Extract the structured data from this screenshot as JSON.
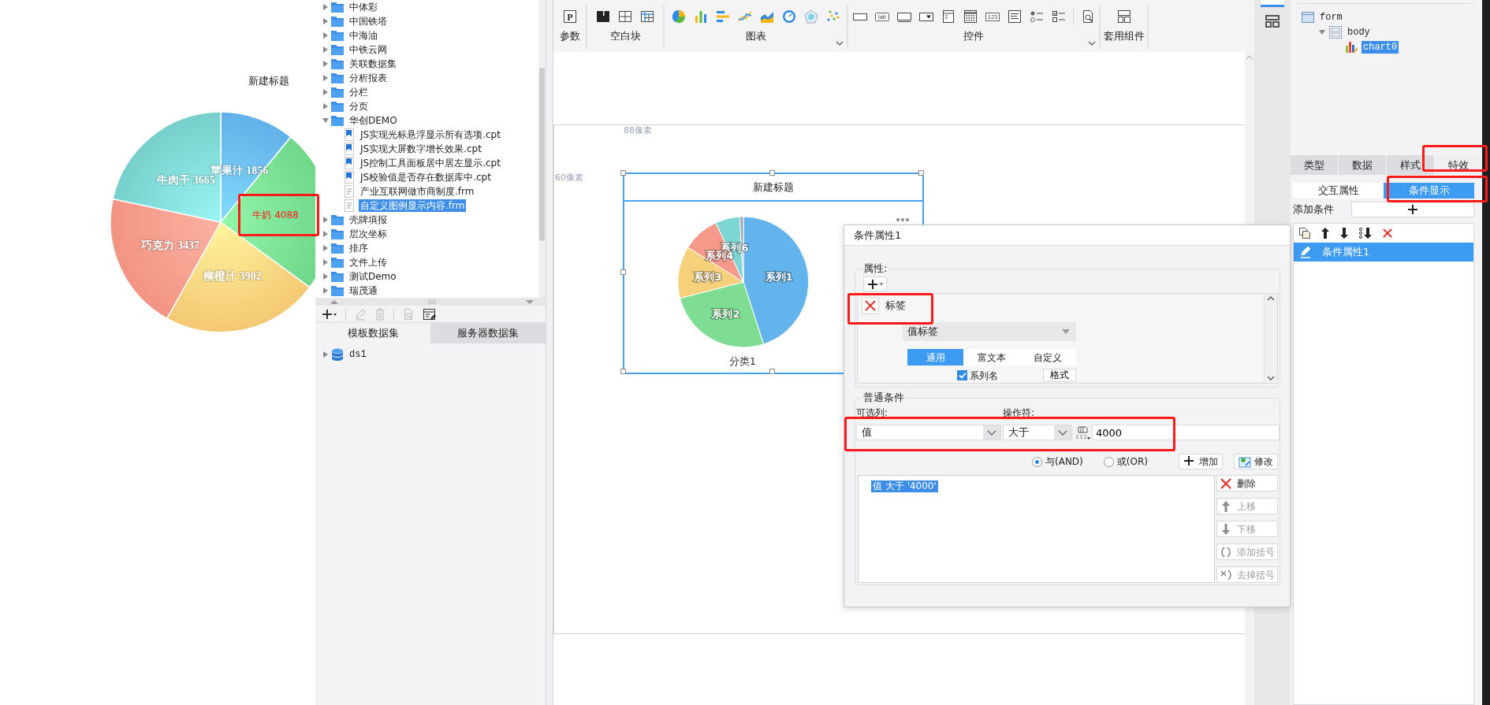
{
  "preview_chart": {
    "chart_data": {
      "type": "pie",
      "title": "新建标题",
      "categories": [
        "苹果汁",
        "牛奶",
        "柳橙汁",
        "巧克力",
        "牛肉干"
      ],
      "values": [
        1856,
        4088,
        3902,
        3437,
        3665
      ],
      "data_labels": true
    },
    "slices": [
      {
        "highlighted": false
      },
      {
        "highlighted": true
      },
      {
        "highlighted": false
      },
      {
        "highlighted": false
      },
      {
        "highlighted": false
      }
    ]
  },
  "file_tree": {
    "items": [
      {
        "label": "中体彩",
        "kind": "folder",
        "expanded": false,
        "selected": false
      },
      {
        "label": "中国铁塔",
        "kind": "folder",
        "expanded": false,
        "selected": false
      },
      {
        "label": "中海油",
        "kind": "folder",
        "expanded": false,
        "selected": false
      },
      {
        "label": "中铁云网",
        "kind": "folder",
        "expanded": false,
        "selected": false
      },
      {
        "label": "关联数据集",
        "kind": "folder",
        "expanded": false,
        "selected": false
      },
      {
        "label": "分析报表",
        "kind": "folder",
        "expanded": false,
        "selected": false
      },
      {
        "label": "分栏",
        "kind": "folder",
        "expanded": false,
        "selected": false
      },
      {
        "label": "分页",
        "kind": "folder",
        "expanded": false,
        "selected": false
      },
      {
        "label": "华创DEMO",
        "kind": "folder",
        "expanded": true,
        "selected": false,
        "children": [
          {
            "label": "JS实现光标悬浮显示所有选项.cpt",
            "kind": "report",
            "selected": false
          },
          {
            "label": "JS实现大屏数字增长效果.cpt",
            "kind": "report",
            "selected": false
          },
          {
            "label": "JS控制工具面板居中居左显示.cpt",
            "kind": "report",
            "selected": false
          },
          {
            "label": "JS校验值是否存在数据库中.cpt",
            "kind": "report",
            "selected": false
          },
          {
            "label": "产业互联网做市商制度.frm",
            "kind": "form",
            "selected": false
          },
          {
            "label": "自定义图例显示内容.frm",
            "kind": "form",
            "selected": true
          }
        ]
      },
      {
        "label": "壳牌填报",
        "kind": "folder",
        "expanded": false,
        "selected": false
      },
      {
        "label": "层次坐标",
        "kind": "folder",
        "expanded": false,
        "selected": false
      },
      {
        "label": "排序",
        "kind": "folder",
        "expanded": false,
        "selected": false
      },
      {
        "label": "文件上传",
        "kind": "folder",
        "expanded": false,
        "selected": false
      },
      {
        "label": "测试Demo",
        "kind": "folder",
        "expanded": false,
        "selected": false
      },
      {
        "label": "瑞茂通",
        "kind": "folder",
        "expanded": false,
        "selected": false
      }
    ]
  },
  "dataset_panel": {
    "tools": [
      {
        "kind": "add",
        "disabled": false
      },
      {
        "kind": "edit",
        "disabled": true
      },
      {
        "kind": "delete",
        "disabled": true
      },
      {
        "kind": "preview",
        "disabled": true
      },
      {
        "kind": "sql",
        "disabled": false
      }
    ],
    "tabs": [
      {
        "label": "模板数据集",
        "selected": true
      },
      {
        "label": "服务器数据集",
        "selected": false
      }
    ],
    "items": [
      {
        "label": "ds1",
        "expanded": false
      }
    ]
  },
  "toolbar": {
    "groups": [
      {
        "label": "参数",
        "menu": false,
        "icons": [
          {
            "kind": "param",
            "text": "P"
          }
        ]
      },
      {
        "label": "空白块",
        "menu": false,
        "icons": [
          {
            "kind": "block"
          },
          {
            "kind": "split"
          },
          {
            "kind": "grid"
          }
        ]
      },
      {
        "label": "图表",
        "menu": true,
        "icons": [
          {
            "kind": "pie"
          },
          {
            "kind": "bar"
          },
          {
            "kind": "hbar"
          },
          {
            "kind": "line"
          },
          {
            "kind": "area"
          },
          {
            "kind": "gauge"
          },
          {
            "kind": "radar"
          },
          {
            "kind": "scatter"
          }
        ]
      },
      {
        "label": "控件",
        "menu": true,
        "icons": [
          {
            "kind": "button"
          },
          {
            "kind": "label",
            "text": "lab"
          },
          {
            "kind": "textfield"
          },
          {
            "kind": "dropdown"
          },
          {
            "kind": "form"
          },
          {
            "kind": "calendar"
          },
          {
            "kind": "number",
            "text": "123"
          },
          {
            "kind": "textarea"
          },
          {
            "kind": "radio"
          },
          {
            "kind": "checkbox"
          },
          {
            "kind": "separator"
          },
          {
            "kind": "preview"
          }
        ]
      },
      {
        "label": "套用组件",
        "menu": false,
        "icons": [
          {
            "kind": "template"
          }
        ]
      }
    ]
  },
  "canvas": {
    "top_offset_label": "88像素",
    "left_offset_label": "60像素",
    "widget": {
      "title": "新建标题",
      "category": "分类1",
      "selected": true,
      "series": [
        {
          "label": "系列1",
          "color": "#63b4ec"
        },
        {
          "label": "系列2",
          "color": "#7edd93"
        },
        {
          "label": "系列3",
          "color": "#f7d07c"
        },
        {
          "label": "系列4",
          "color": "#f59a8b"
        },
        {
          "label": "系列6",
          "color": "#7dd6d3"
        },
        {
          "color": "#9fa3b8"
        }
      ]
    }
  },
  "dialog": {
    "title": "条件属性1",
    "properties": {
      "legend": "属性:",
      "property_name": "标签",
      "label_type": "值标签",
      "tabs": [
        {
          "label": "通用",
          "selected": true
        },
        {
          "label": "富文本",
          "selected": false
        },
        {
          "label": "自定义",
          "selected": false
        }
      ],
      "series_name": {
        "label": "系列名",
        "checked": true
      },
      "format_button": "格式"
    },
    "conditions": {
      "legend": "普通条件",
      "column_label": "可选列:",
      "operator_label": "操作符:",
      "column": "值",
      "operator": "大于",
      "value": "4000",
      "logic": [
        {
          "label": "与(AND)",
          "selected": true
        },
        {
          "label": "或(OR)",
          "selected": false
        }
      ],
      "buttons": [
        {
          "label": "增加",
          "kind": "add"
        },
        {
          "label": "修改",
          "kind": "edit"
        }
      ],
      "list": [
        {
          "text": "值 大于 '4000'",
          "selected": true
        }
      ],
      "side_buttons": [
        {
          "label": "删除",
          "kind": "delete",
          "disabled": false
        },
        {
          "label": "上移",
          "kind": "up",
          "disabled": true
        },
        {
          "label": "下移",
          "kind": "down",
          "disabled": true
        },
        {
          "label": "添加括号",
          "kind": "add-bracket",
          "disabled": true
        },
        {
          "label": "去掉括号",
          "kind": "remove-bracket",
          "disabled": true
        }
      ]
    }
  },
  "properties_panel": {
    "widget_tree": [
      {
        "label": "form",
        "kind": "form",
        "selected": false,
        "children": [
          {
            "label": "body",
            "kind": "body",
            "selected": false,
            "expanded": true,
            "children": [
              {
                "label": "chart0",
                "kind": "chart",
                "selected": true
              }
            ]
          }
        ]
      }
    ],
    "tabs": [
      {
        "label": "类型",
        "selected": false
      },
      {
        "label": "数据",
        "selected": false
      },
      {
        "label": "样式",
        "selected": false
      },
      {
        "label": "特效",
        "selected": true
      }
    ],
    "subtabs": [
      {
        "label": "交互属性",
        "selected": false
      },
      {
        "label": "条件显示",
        "selected": true
      }
    ],
    "add_condition_label": "添加条件",
    "conditions": [
      {
        "label": "条件属性1",
        "selected": true
      }
    ]
  }
}
